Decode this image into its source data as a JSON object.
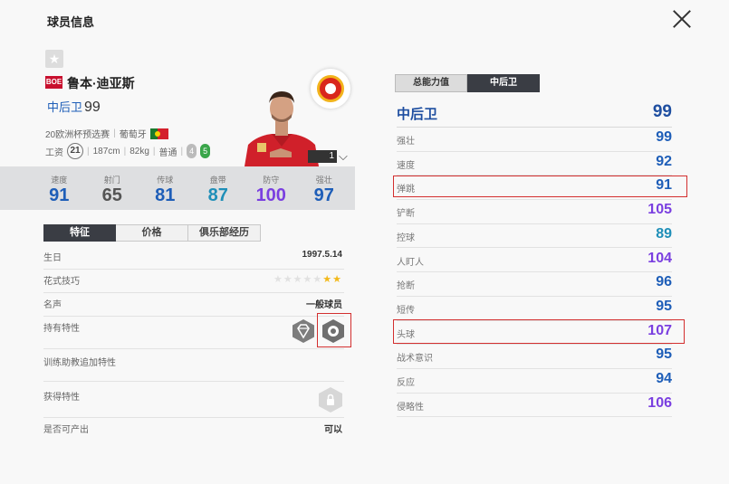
{
  "title": "球员信息",
  "player": {
    "season_badge": "BOE",
    "name": "鲁本·迪亚斯",
    "position": "中后卫",
    "overall": "99",
    "league": "20欧洲杯预选赛",
    "nation": "葡萄牙",
    "salary_label": "工资",
    "salary": "21",
    "height": "187cm",
    "weight": "82kg",
    "body_type": "普通",
    "weak_foot": "4",
    "skill_moves": "5",
    "level": "1"
  },
  "stats": [
    {
      "label": "速度",
      "value": "91",
      "color": "#1e5eb8"
    },
    {
      "label": "射门",
      "value": "65",
      "color": "#555555"
    },
    {
      "label": "传球",
      "value": "81",
      "color": "#1e5eb8"
    },
    {
      "label": "盘带",
      "value": "87",
      "color": "#1f8fb8"
    },
    {
      "label": "防守",
      "value": "100",
      "color": "#7a3fe0"
    },
    {
      "label": "强壮",
      "value": "97",
      "color": "#1e5eb8"
    }
  ],
  "left_tabs": [
    "特征",
    "价格",
    "俱乐部经历"
  ],
  "info": {
    "birthday_label": "生日",
    "birthday": "1997.5.14",
    "skill_label": "花式技巧",
    "skill_stars": 2,
    "fame_label": "名声",
    "fame": "一般球员",
    "traits_label": "持有特性",
    "coach_label": "训练助教追加特性",
    "acquired_label": "获得特性",
    "tradable_label": "是否可产出",
    "tradable": "可以"
  },
  "right_tabs": [
    "总能力值",
    "中后卫"
  ],
  "position_header": {
    "name": "中后卫",
    "value": "99"
  },
  "attributes": [
    {
      "name": "强壮",
      "value": "99",
      "color": "#1e5eb8"
    },
    {
      "name": "速度",
      "value": "92",
      "color": "#1e5eb8"
    },
    {
      "name": "弹跳",
      "value": "91",
      "color": "#1e5eb8"
    },
    {
      "name": "铲断",
      "value": "105",
      "color": "#7a3fe0"
    },
    {
      "name": "控球",
      "value": "89",
      "color": "#1f8fb8"
    },
    {
      "name": "人盯人",
      "value": "104",
      "color": "#7a3fe0"
    },
    {
      "name": "抢断",
      "value": "96",
      "color": "#1e5eb8"
    },
    {
      "name": "短传",
      "value": "95",
      "color": "#1e5eb8"
    },
    {
      "name": "头球",
      "value": "107",
      "color": "#7a3fe0"
    },
    {
      "name": "战术意识",
      "value": "95",
      "color": "#1e5eb8"
    },
    {
      "name": "反应",
      "value": "94",
      "color": "#1e5eb8"
    },
    {
      "name": "侵略性",
      "value": "106",
      "color": "#7a3fe0"
    }
  ]
}
